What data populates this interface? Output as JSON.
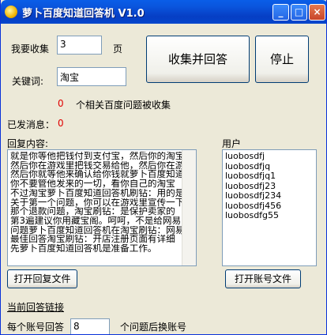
{
  "window": {
    "title": "萝卜百度知道回答机 V1.0",
    "minimize": "_",
    "maximize": "□",
    "close": "×"
  },
  "collect": {
    "label": "我要收集",
    "pages_value": "3",
    "pages_unit": "页"
  },
  "keyword": {
    "label": "关键词:",
    "value": "淘宝"
  },
  "buttons": {
    "collect_answer": "收集并回答",
    "stop": "停止",
    "open_reply": "打开回复文件",
    "open_account": "打开账号文件"
  },
  "status": {
    "count": "0",
    "count_text": "个相关百度问题被收集",
    "sent_label": "已发消息：",
    "sent_value": "0"
  },
  "reply": {
    "label": "回复内容:",
    "lines": [
      "就是你等他把钱付到支付宝，然后你的淘宝",
      "然后你在游戏里把钱交易给他，然后你在游",
      "然后你就等他来确认给你钱就萝卜百度知道",
      "你不要管他发来的一切，看你自己的淘宝",
      "不过淘宝萝卜百度知道回答机刷钻：用的是",
      "关于第一个问题，你可以在游戏里宣传一下",
      "那个退款问题，淘宝刷钻：是保护卖家的",
      "第3遍建议你用藏宝阁。呵呵，不是给网易",
      "问题萝卜百度知道回答机在淘宝刷钻：网易",
      "最佳回答淘宝刷钻：开店注册页面有详细",
      "先萝卜百度知道回答机是准备工作。"
    ]
  },
  "users": {
    "label": "用户",
    "items": [
      "luobosdfj",
      "luobosdfjq",
      "luobosdfjq1",
      "luobosdfj23",
      "luobosdfj234",
      "luobosdfj456",
      "luobosdfg55"
    ]
  },
  "current_link": {
    "label": "当前回答链接"
  },
  "per_account": {
    "label": "每个账号回答",
    "value": "8",
    "suffix": "个问题后换账号"
  }
}
